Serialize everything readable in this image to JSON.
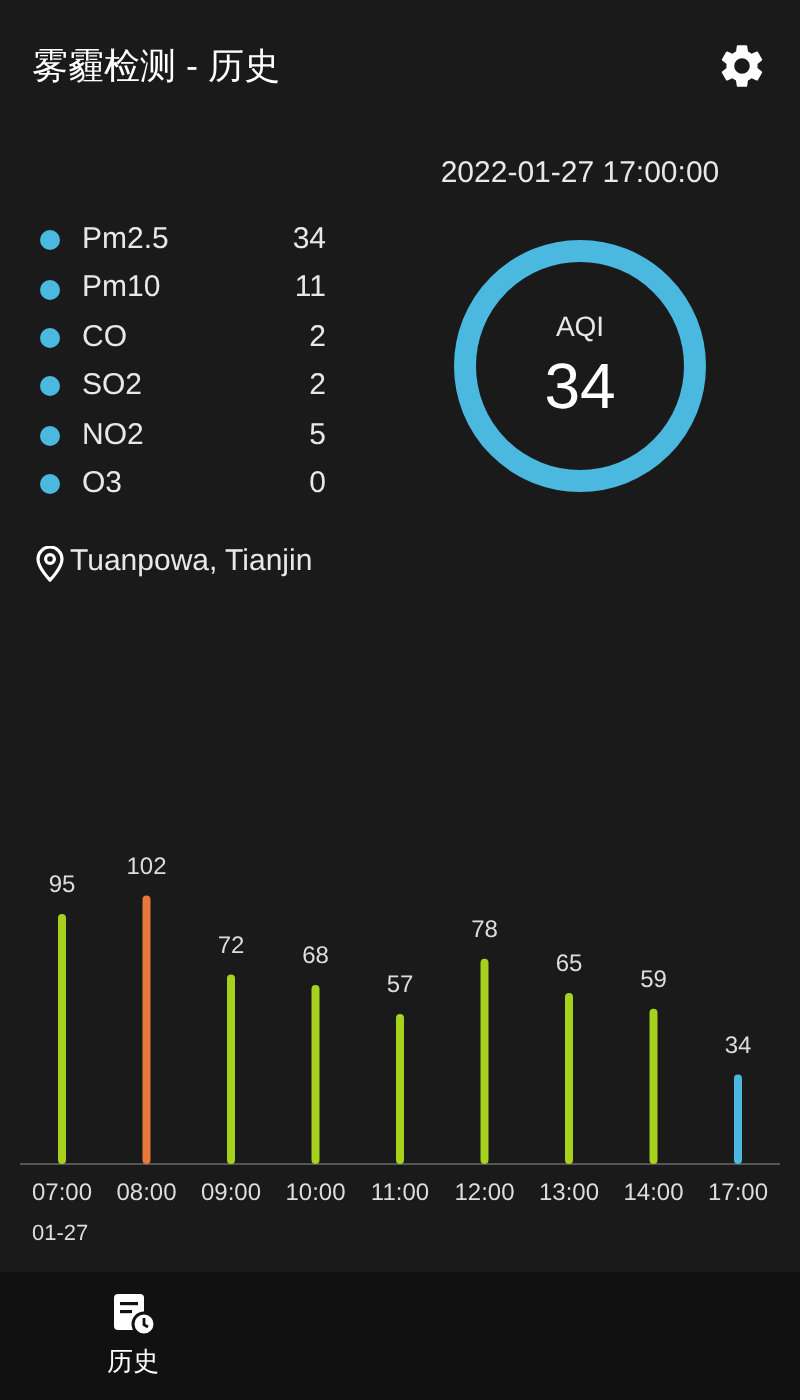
{
  "app_bar": {
    "title": "雾霾检测 - 历史"
  },
  "timestamp": "2022-01-27 17:00:00",
  "pollutants": [
    {
      "name": "Pm2.5",
      "value": "34"
    },
    {
      "name": "Pm10",
      "value": "11"
    },
    {
      "name": "CO",
      "value": "2"
    },
    {
      "name": "SO2",
      "value": "2"
    },
    {
      "name": "NO2",
      "value": "5"
    },
    {
      "name": "O3",
      "value": "0"
    }
  ],
  "aqi": {
    "label": "AQI",
    "value": "34"
  },
  "location": "Tuanpowa, Tianjin",
  "history": {
    "chart_data": {
      "type": "bar",
      "categories": [
        "07:00",
        "08:00",
        "09:00",
        "10:00",
        "11:00",
        "12:00",
        "13:00",
        "14:00",
        "17:00"
      ],
      "series": [
        {
          "color": "#a6d21e",
          "values": [
            95,
            null,
            72,
            68,
            57,
            78,
            65,
            59,
            null
          ]
        },
        {
          "color": "#e8793a",
          "values": [
            null,
            102,
            null,
            null,
            null,
            null,
            null,
            null,
            null
          ]
        },
        {
          "color": "#4bb8e0",
          "values": [
            null,
            null,
            null,
            null,
            null,
            null,
            null,
            null,
            34
          ]
        }
      ],
      "data_labels": true
    },
    "date_label": "01-27"
  },
  "bottom_nav": [
    {
      "label": "历史"
    }
  ]
}
